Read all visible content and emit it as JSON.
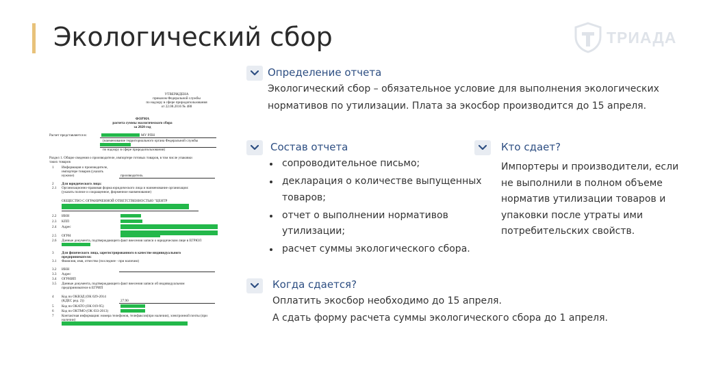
{
  "header": {
    "title": "Экологический сбор"
  },
  "logo": {
    "text": "ТРИАДА",
    "icon": "shield-logo-icon"
  },
  "document": {
    "approved": "УТВЕРЖДЕНА",
    "approved_l1": "приказом Федеральной службы",
    "approved_l2": "по надзору в сфере природопользования",
    "approved_l3": "от 22.08.2016 № 488",
    "form_l1": "ФОРМА",
    "form_l2": "расчета суммы экологического сбора",
    "form_l3": "за 2020 год",
    "submitted_to": "Расчет представляется в:",
    "submitted_org": "МУ РПН",
    "org_note1": "(наименование территориального органа Федеральной службы",
    "org_note2": "по надзору в сфере природопользования)",
    "section1_l1": "Раздел 1. Общие сведения о производителе, импортере готовых товаров, в том числе упаковки",
    "section1_l2": "таких товаров",
    "r1_num": "1",
    "r1_l1": "Информация о производителе,",
    "r1_l2": "импортере товаров (указать",
    "r1_l3": "нужное)",
    "r1_value": "производитель",
    "r2_num": "2",
    "r2_text": "Для юридического лица:",
    "r21_num": "2.1",
    "r21_l1": "Организационно-правовая форма юридического лица и наименование организации:",
    "r21_l2": "(указать полное и сокращенное, фирменное наименование)",
    "org_name": "ОБЩЕСТВО С ОГРАНИЧЕННОЙ ОТВЕТСТВЕННОСТЬЮ \"ЦЕНТР",
    "r22_num": "2.2",
    "r22_text": "ИНН",
    "r23_num": "2.3",
    "r23_text": "КПП",
    "r24_num": "2.4",
    "r24_text": "Адрес",
    "r25_num": "2.5",
    "r25_text": "ОГРН",
    "r26_num": "2.6",
    "r26_text": "Данные документа, подтверждающего факт внесения записи о юридическом лице в ЕГРЮЛ",
    "r3_num": "3",
    "r3_l1": "Для физического лица, зарегистрированного в качестве индивидуального",
    "r3_l2": "предпринимателя:",
    "r31_num": "3.1",
    "r31_text": "Фамилия, имя, отчество (последнее - при наличии)",
    "r32_num": "3.2",
    "r32_text": "ИНН",
    "r33_num": "3.3",
    "r33_text": "Адрес",
    "r34_num": "3.4",
    "r34_text": "ОГРНИП",
    "r35_num": "3.5",
    "r35_l1": "Данные документа, подтверждающего факт внесения записи об индивидуальном",
    "r35_l2": "предпринимателе в ЕГРИП",
    "r4_num": "4",
    "r4_l1": "Код по ОКВЭД (ОК 029-2014",
    "r4_l2": "(КДЕС ред. 2))",
    "r4_value": "27.90",
    "r5_num": "5",
    "r5_text": "Код по ОКАТО (ОК 019-95)",
    "r6_num": "6",
    "r6_text": "Код по ОКТМО (ОК 033-2013)",
    "r7_num": "7",
    "r7_l1": "Контактная информация: номера телефонов, телефаксов(при наличии), электронной почты (при",
    "r7_l2": "наличии)"
  },
  "sections": {
    "definition": {
      "title": "Определение отчета",
      "line1": "Экологический сбор – обязательное условие для выполнения экологических",
      "line2": "нормативов по утилизации. Плата за экосбор производится до 15 апреля."
    },
    "composition": {
      "title": "Состав отчета",
      "items": [
        "сопроводительное письмо;",
        "декларация о количестве выпущенных товаров;",
        "отчет о выполнении нормативов утилизации;",
        "расчет суммы экологического сбора."
      ]
    },
    "who": {
      "title": "Кто сдает?",
      "text": "Импортеры и производители, если не выполнили в полном объеме норматив утилизации товаров и упаковки после утраты ими потребительских свойств."
    },
    "when": {
      "title": "Когда сдается?",
      "line1": "Оплатить экосбор необходимо до 15 апреля.",
      "line2": "А сдать форму расчета суммы экологического сбора до 1 апреля."
    }
  },
  "colors": {
    "accent_bar": "#e8c27a",
    "section_title": "#2d4e82",
    "chevron_bg": "#e8ecf2",
    "redaction": "#23b84a"
  }
}
